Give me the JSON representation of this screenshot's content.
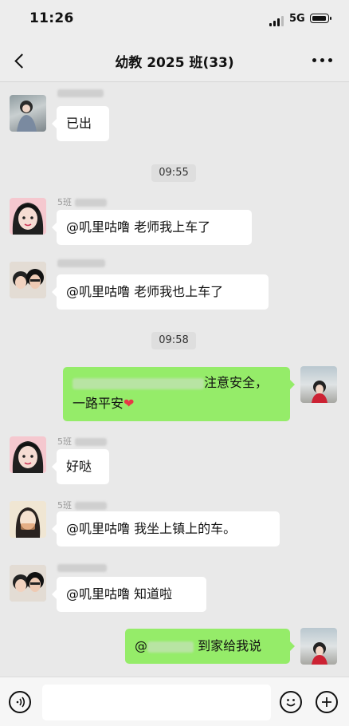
{
  "status_bar": {
    "time": "11:26",
    "network": "5G"
  },
  "nav": {
    "title": "幼教 2025 班(33)"
  },
  "timestamps": [
    "09:55",
    "09:58"
  ],
  "messages": [
    {
      "text": "已出"
    },
    {
      "sender": "5班",
      "text": "@叽里咕噜 老师我上车了"
    },
    {
      "text": "@叽里咕噜 老师我也上车了"
    },
    {
      "line1": "注意安全，",
      "line2": "一路平安",
      "heart": "❤"
    },
    {
      "sender": "5班",
      "text": "好哒"
    },
    {
      "sender": "5班",
      "text": "@叽里咕噜 我坐上镇上的车。"
    },
    {
      "text": "@叽里咕噜 知道啦"
    },
    {
      "text": "到家给我说"
    }
  ],
  "input": {
    "placeholder": ""
  },
  "icons": {
    "back": "chevron-left-icon",
    "more": "more-icon",
    "voice": "voice-icon",
    "emoji": "emoji-icon",
    "add": "add-icon"
  },
  "colors": {
    "my_bubble": "#95ec69",
    "chat_bg": "#e9e9e9"
  }
}
